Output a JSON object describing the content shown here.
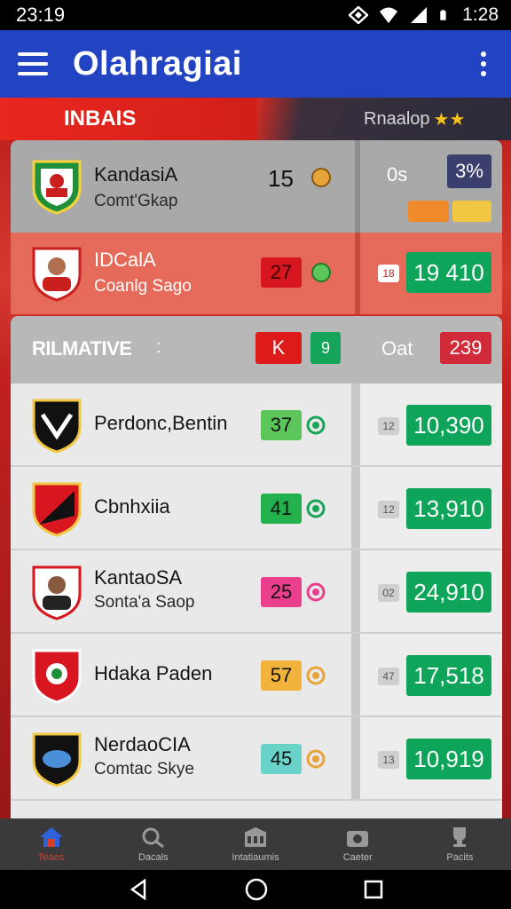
{
  "status_bar": {
    "time_left": "23:19",
    "time_right": "1:28"
  },
  "app_bar": {
    "title": "Olahragiai"
  },
  "banner": {
    "left_text": "INBAIS",
    "right_text": "Rnaalop"
  },
  "top_rows": [
    {
      "name": "KandasiA",
      "sub": "Comt'Gkap",
      "score": "15",
      "chip": "0s",
      "value": "3%",
      "style": "grey"
    },
    {
      "name": "IDCalA",
      "sub": "Coanlg Sago",
      "score": "27",
      "chip": "18",
      "value": "19 410",
      "style": "red"
    }
  ],
  "section": {
    "title": "RILMATIVE",
    "colon": ":",
    "k_label": "K",
    "g_label": "9",
    "oat_label": "Oat",
    "value": "239"
  },
  "list": [
    {
      "name": "Perdonc,Bentin",
      "sub": "",
      "score": "37",
      "score_color": "#5cc65a",
      "icon_color": "#19a558",
      "chip": "12",
      "value": "10,390"
    },
    {
      "name": "Cbnhxiia",
      "sub": "",
      "score": "41",
      "score_color": "#22b14c",
      "icon_color": "#19a558",
      "chip": "12",
      "value": "13,910"
    },
    {
      "name": "KantaoSA",
      "sub": "Sonta'a Saop",
      "score": "25",
      "score_color": "#ea3f8c",
      "icon_color": "#ea3f8c",
      "chip": "02",
      "value": "24,910"
    },
    {
      "name": "Hdaka Paden",
      "sub": "",
      "score": "57",
      "score_color": "#f2b33d",
      "icon_color": "#e6a43a",
      "chip": "47",
      "value": "17,518"
    },
    {
      "name": "NerdaoCIA",
      "sub": "Comtac Skye",
      "score": "45",
      "score_color": "#6ad3c9",
      "icon_color": "#e6a43a",
      "chip": "13",
      "value": "10,919"
    }
  ],
  "bottom_nav": [
    {
      "label": "Teaes",
      "icon": "home-icon"
    },
    {
      "label": "Dacals",
      "icon": "whistle-icon"
    },
    {
      "label": "Intatiaumis",
      "icon": "stadium-icon"
    },
    {
      "label": "Caeter",
      "icon": "camera-icon"
    },
    {
      "label": "Pacits",
      "icon": "trophy-icon"
    }
  ]
}
